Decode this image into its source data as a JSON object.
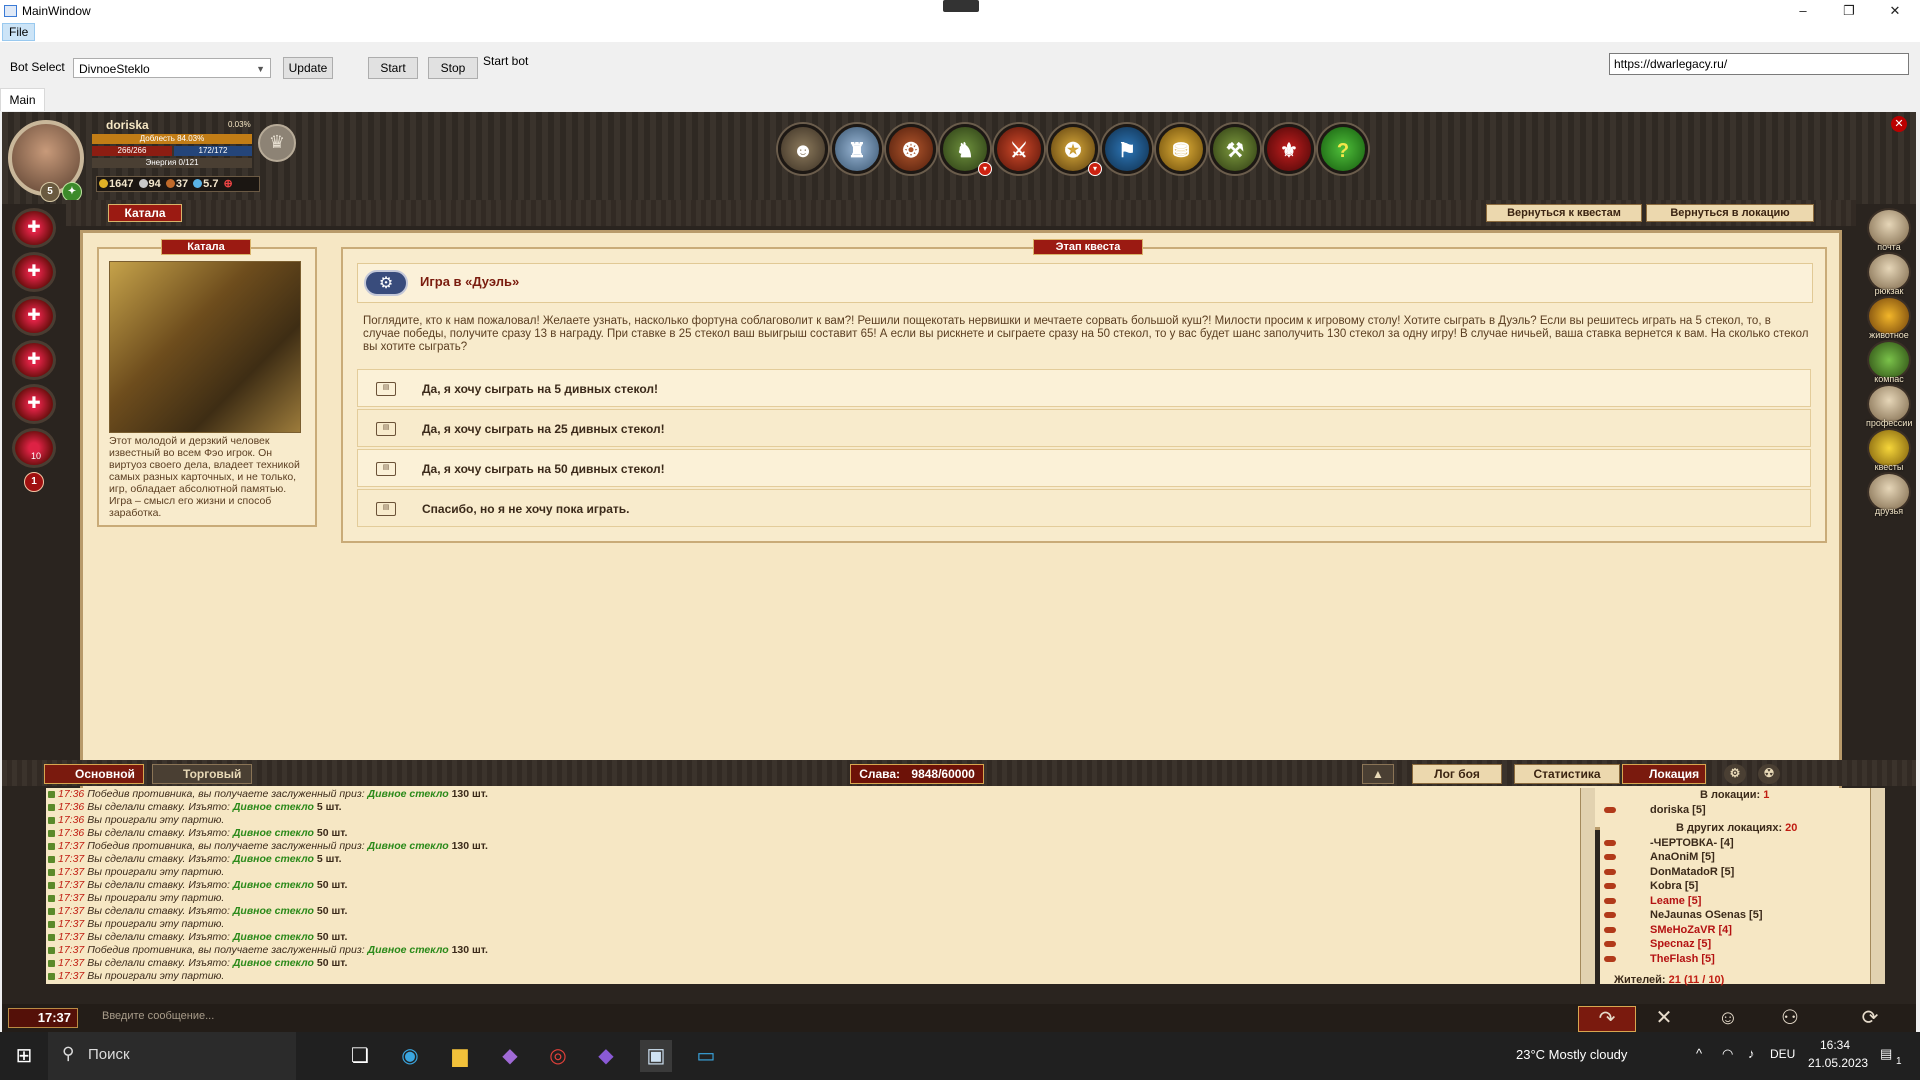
{
  "window": {
    "title": "MainWindow",
    "controls": {
      "minimize": "–",
      "maximize": "❐",
      "close": "✕"
    }
  },
  "menu": {
    "file": "File"
  },
  "toolbar": {
    "bot_select_label": "Bot Select",
    "bot_select_value": "DivnoeSteklo",
    "update": "Update",
    "start": "Start",
    "stop": "Stop",
    "status": "Start bot",
    "url": "https://dwarlegacy.ru/"
  },
  "tabs": {
    "main": "Main"
  },
  "character": {
    "name": "doriska",
    "percent": "0.03%",
    "courage": "Доблесть 84.03%",
    "hp": "266/266",
    "mana": "172/172",
    "energy": "Энергия 0/121",
    "level": "5",
    "gold": "1647",
    "silver": "94",
    "copper": "37",
    "gems": "5.7"
  },
  "skills": {
    "last_count": "10",
    "badge": "1"
  },
  "location": {
    "name": "Катала",
    "back_quests": "Вернуться к квестам",
    "back_location": "Вернуться в локацию"
  },
  "right_menu": [
    "почта",
    "рюкзак",
    "животное",
    "компас",
    "профессии",
    "квесты",
    "друзья"
  ],
  "npc": {
    "name": "Катала",
    "description": "Этот молодой и дерзкий человек известный во всем Фэо игрок. Он виртуоз своего дела, владеет техникой самых разных карточных, и не только, игр, обладает абсолютной памятью. Игра – смысл его жизни и способ заработка."
  },
  "quest": {
    "stage_label": "Этап квеста",
    "title": "Игра в «Дуэль»",
    "text": "Поглядите, кто к нам пожаловал! Желаете узнать, насколько фортуна соблаговолит к вам?! Решили пощекотать нервишки и мечтаете сорвать большой куш?! Милости просим к игровому столу! Хотите сыграть в Дуэль? Если вы решитесь играть на 5 стекол, то, в случае победы, получите сразу 13 в награду. При ставке в 25 стекол ваш выигрыш составит 65! А если вы рискнете и сыграете сразу на 50 стекол, то у вас будет шанс заполучить 130 стекол за одну игру! В случае ничьей, ваша ставка вернется к вам. На сколько стекол вы хотите сыграть?",
    "options": [
      "Да, я хочу сыграть на 5 дивных стекол!",
      "Да, я хочу сыграть на 25 дивных стекол!",
      "Да, я хочу сыграть на 50 дивных стекол!",
      "Спасибо, но я не хочу пока играть."
    ]
  },
  "chat": {
    "tab_main": "Основной",
    "tab_trade": "Торговый",
    "glory_label": "Слава:",
    "glory_value": "9848/60000",
    "battle_log": "Лог боя",
    "statistics": "Статистика",
    "location_tab": "Локация",
    "log": [
      {
        "time": "17:36",
        "text": "Победив противника, вы получаете заслуженный приз:",
        "item": "Дивное стекло",
        "qty": "130 шт."
      },
      {
        "time": "17:36",
        "text": "Вы сделали ставку. Изъято:",
        "item": "Дивное стекло",
        "qty": "5 шт."
      },
      {
        "time": "17:36",
        "text": "Вы проиграли эту партию.",
        "item": "",
        "qty": ""
      },
      {
        "time": "17:36",
        "text": "Вы сделали ставку. Изъято:",
        "item": "Дивное стекло",
        "qty": "50 шт."
      },
      {
        "time": "17:37",
        "text": "Победив противника, вы получаете заслуженный приз:",
        "item": "Дивное стекло",
        "qty": "130 шт."
      },
      {
        "time": "17:37",
        "text": "Вы сделали ставку. Изъято:",
        "item": "Дивное стекло",
        "qty": "5 шт."
      },
      {
        "time": "17:37",
        "text": "Вы проиграли эту партию.",
        "item": "",
        "qty": ""
      },
      {
        "time": "17:37",
        "text": "Вы сделали ставку. Изъято:",
        "item": "Дивное стекло",
        "qty": "50 шт."
      },
      {
        "time": "17:37",
        "text": "Вы проиграли эту партию.",
        "item": "",
        "qty": ""
      },
      {
        "time": "17:37",
        "text": "Вы сделали ставку. Изъято:",
        "item": "Дивное стекло",
        "qty": "50 шт."
      },
      {
        "time": "17:37",
        "text": "Вы проиграли эту партию.",
        "item": "",
        "qty": ""
      },
      {
        "time": "17:37",
        "text": "Вы сделали ставку. Изъято:",
        "item": "Дивное стекло",
        "qty": "50 шт."
      },
      {
        "time": "17:37",
        "text": "Победив противника, вы получаете заслуженный приз:",
        "item": "Дивное стекло",
        "qty": "130 шт."
      },
      {
        "time": "17:37",
        "text": "Вы сделали ставку. Изъято:",
        "item": "Дивное стекло",
        "qty": "50 шт."
      },
      {
        "time": "17:37",
        "text": "Вы проиграли эту партию.",
        "item": "",
        "qty": ""
      }
    ],
    "location_panel": {
      "in_location_label": "В локации:",
      "in_location_count": "1",
      "other_locations_label": "В других локациях:",
      "other_locations_count": "20",
      "players_here": [
        "doriska [5]"
      ],
      "players_other": [
        "-ЧЕРТОВКА- [4]",
        "AnaOniM [5]",
        "DonMatadoR [5]",
        "Kobra [5]",
        "Leame [5]",
        "NeJaunas OSenas [5]",
        "SMeHoZaVR [4]",
        "Specnaz [5]",
        "TheFlash [5]"
      ],
      "red_players": [
        "Leame [5]",
        "SMeHoZaVR [4]",
        "Specnaz [5]",
        "TheFlash [5]"
      ],
      "residents_label": "Жителей:",
      "residents_value": "21 (11 / 10)"
    },
    "clock": "17:37",
    "input_placeholder": "Введите сообщение..."
  },
  "taskbar": {
    "search": "Поиск",
    "weather": "23°C  Mostly cloudy",
    "lang": "DEU",
    "time": "16:34",
    "date": "21.05.2023",
    "notifications": "1"
  },
  "colors": {
    "accent_red": "#9b1a12",
    "parchment": "#f6e7c4",
    "item_green": "#2b8a1a"
  }
}
